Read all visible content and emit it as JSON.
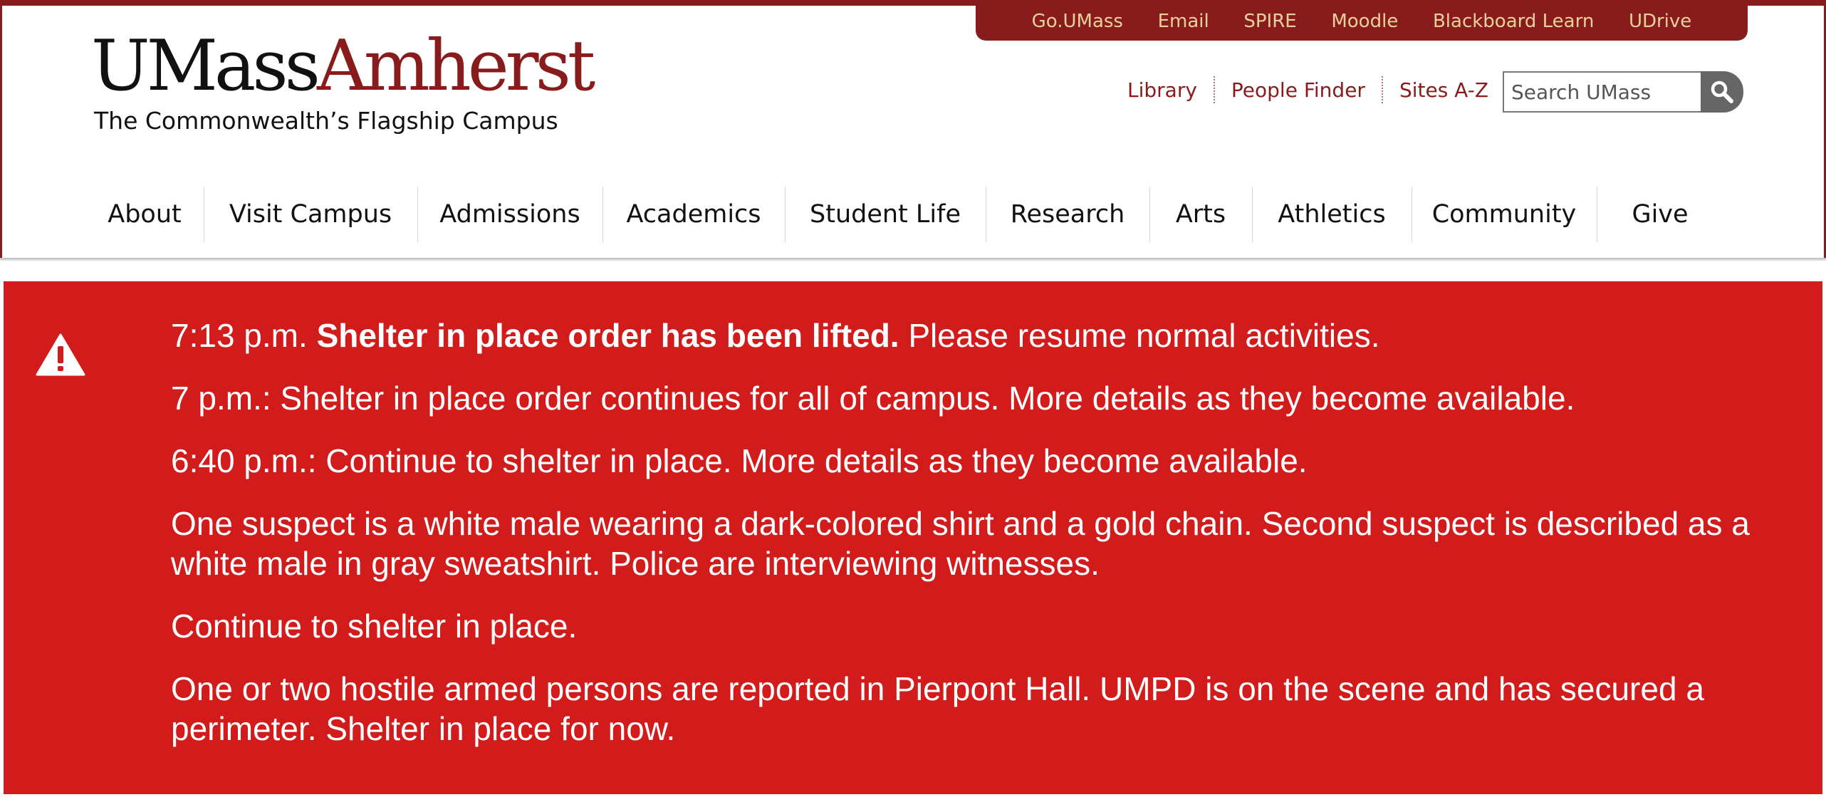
{
  "utility_links": [
    "Go.UMass",
    "Email",
    "SPIRE",
    "Moodle",
    "Blackboard Learn",
    "UDrive"
  ],
  "logo": {
    "umass": "UMass",
    "amherst": "Amherst",
    "tagline": "The Commonwealth’s Flagship Campus"
  },
  "secondary_links": [
    "Library",
    "People Finder",
    "Sites A-Z"
  ],
  "search": {
    "placeholder": "Search UMass"
  },
  "main_nav": [
    "About",
    "Visit Campus",
    "Admissions",
    "Academics",
    "Student Life",
    "Research",
    "Arts",
    "Athletics",
    "Community",
    "Give"
  ],
  "alert": {
    "icon": "warning-triangle-icon",
    "messages": [
      {
        "time": "7:13 p.m. ",
        "bold": "Shelter in place order has been lifted.",
        "text": " Please resume normal activities."
      },
      {
        "text": "7 p.m.: Shelter in place order continues for all of campus. More details as they become available."
      },
      {
        "text": "6:40 p.m.: Continue to shelter in place. More details as they become available."
      },
      {
        "text": "One suspect is a white male wearing a dark-colored shirt and a gold chain. Second suspect is described as a white male in gray sweatshirt. Police are  interviewing witnesses."
      },
      {
        "text": "Continue to shelter in place."
      },
      {
        "text": "One or two hostile armed persons are reported in Pierpont Hall. UMPD is on the scene and has secured a perimeter. Shelter in place for now."
      }
    ]
  },
  "colors": {
    "maroon": "#881c1c",
    "gold_text": "#e8d29c",
    "alert_red": "#d21c1c"
  }
}
